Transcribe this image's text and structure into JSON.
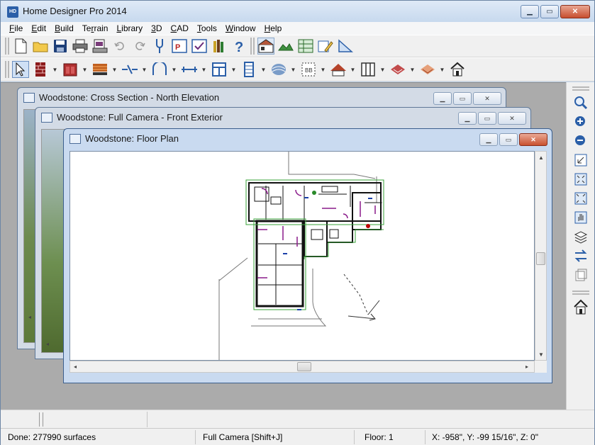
{
  "app": {
    "title": "Home Designer Pro 2014",
    "icon_text": "HD"
  },
  "menu": [
    {
      "label": "File",
      "mnemonic": "F",
      "rest": "ile"
    },
    {
      "label": "Edit",
      "mnemonic": "E",
      "rest": "dit"
    },
    {
      "label": "Build",
      "mnemonic": "B",
      "rest": "uild"
    },
    {
      "label": "Terrain",
      "mnemonic": "T",
      "rest": "errain",
      "pre": "Te",
      "mid": "r",
      "post": "rain"
    },
    {
      "label": "Library",
      "mnemonic": "L",
      "rest": "ibrary"
    },
    {
      "label": "3D",
      "mnemonic": "3",
      "rest": "D"
    },
    {
      "label": "CAD",
      "mnemonic": "C",
      "rest": "AD"
    },
    {
      "label": "Tools",
      "mnemonic": "T",
      "rest": "ools"
    },
    {
      "label": "Window",
      "mnemonic": "W",
      "rest": "indow"
    },
    {
      "label": "Help",
      "mnemonic": "H",
      "rest": "elp"
    }
  ],
  "windows": {
    "cross_section": {
      "title": "Woodstone: Cross Section - North Elevation"
    },
    "full_camera": {
      "title": "Woodstone: Full Camera - Front Exterior"
    },
    "floor_plan": {
      "title": "Woodstone: Floor Plan"
    }
  },
  "status": {
    "message": "Done:  277990 surfaces",
    "tool": "Full Camera [Shift+J]",
    "floor": "Floor: 1",
    "coords": "X: -958\", Y: -99 15/16\", Z: 0\""
  },
  "colors": {
    "accent": "#2b5fa8",
    "title_active": "#c9daf0",
    "close_red": "#c74e2f"
  }
}
